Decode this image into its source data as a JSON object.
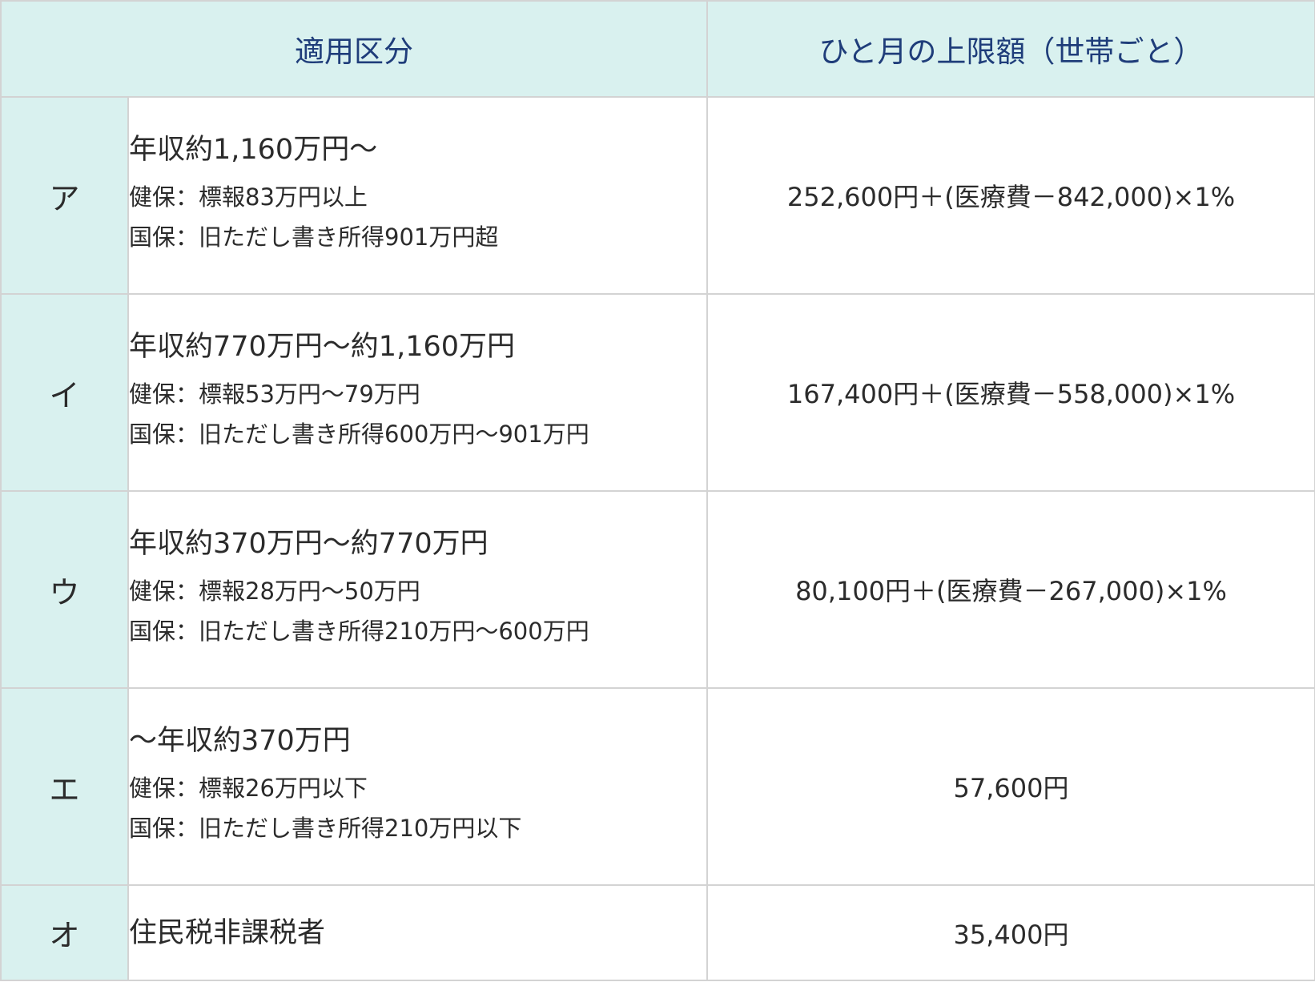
{
  "header": {
    "category_label": "適用区分",
    "limit_label": "ひと月の上限額（世帯ごと）"
  },
  "rows": [
    {
      "category": "ア",
      "income": "年収約1,160万円～",
      "kenpo": "健保：標報83万円以上",
      "kokuho": "国保：旧ただし書き所得901万円超",
      "limit": "252,600円＋(医療費－842,000)×1%"
    },
    {
      "category": "イ",
      "income": "年収約770万円～約1,160万円",
      "kenpo": "健保：標報53万円～79万円",
      "kokuho": "国保：旧ただし書き所得600万円～901万円",
      "limit": "167,400円＋(医療費－558,000)×1%"
    },
    {
      "category": "ウ",
      "income": "年収約370万円～約770万円",
      "kenpo": "健保：標報28万円～50万円",
      "kokuho": "国保：旧ただし書き所得210万円～600万円",
      "limit": "80,100円＋(医療費－267,000)×1%"
    },
    {
      "category": "エ",
      "income": "～年収約370万円",
      "kenpo": "健保：標報26万円以下",
      "kokuho": "国保：旧ただし書き所得210万円以下",
      "limit": "57,600円"
    },
    {
      "category": "オ",
      "income": "住民税非課税者",
      "limit": "35,400円"
    }
  ]
}
